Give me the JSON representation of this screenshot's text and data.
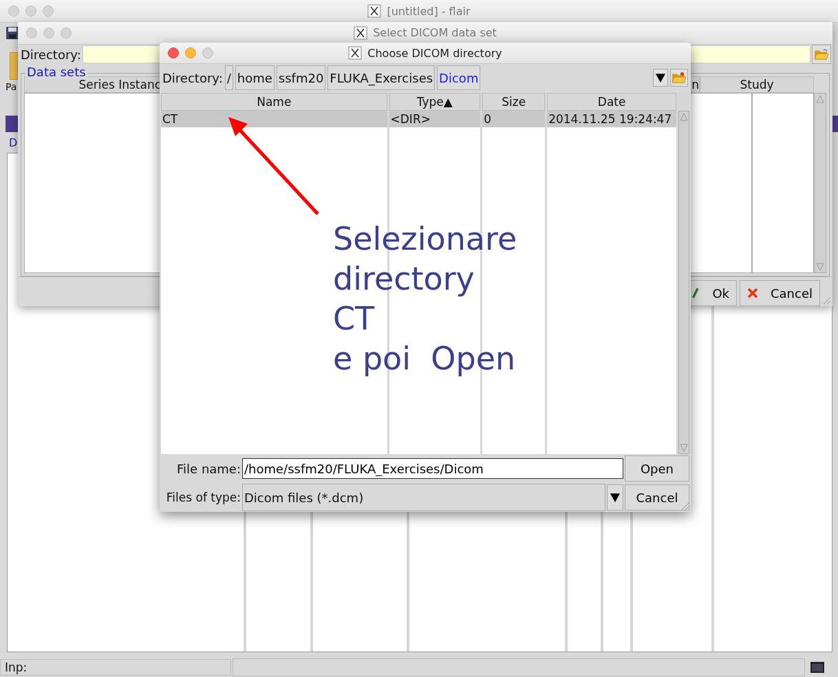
{
  "main_window": {
    "title": "[untitled] - flair",
    "toolbar_fragment": "Pa",
    "panel_fragment": "D",
    "status_bar": {
      "input_label": "Inp:"
    }
  },
  "data_set_window": {
    "title": "Select DICOM data set",
    "directory_label": "Directory:",
    "group_label": "Data sets",
    "columns": [
      "Series Instanc",
      "n",
      "Study"
    ],
    "buttons": [
      {
        "label": "Ok",
        "kind": "ok"
      },
      {
        "label": "Cancel",
        "kind": "cancel"
      }
    ]
  },
  "dialog": {
    "title": "Choose DICOM directory",
    "directory_label": "Directory:",
    "path": [
      {
        "label": "/",
        "selected": false
      },
      {
        "label": "home",
        "selected": false
      },
      {
        "label": "ssfm20",
        "selected": false
      },
      {
        "label": "FLUKA_Exercises",
        "selected": false
      },
      {
        "label": "Dicom",
        "selected": true
      }
    ],
    "columns": [
      "Name",
      "Type▲",
      "Size",
      "Date"
    ],
    "rows": [
      {
        "cells": [
          "CT",
          "<DIR>",
          "0",
          "2014.11.25 19:24:47"
        ],
        "selected": true
      }
    ],
    "file_name_label": "File name:",
    "file_name": "/home/ssfm20/FLUKA_Exercises/Dicom",
    "file_type_label": "Files of type:",
    "file_type": "Dicom files (*.dcm)",
    "buttons": [
      "Open",
      "Cancel"
    ]
  },
  "annotation": {
    "lines": [
      "Selezionare",
      "directory",
      "CT",
      "e poi  Open"
    ]
  }
}
